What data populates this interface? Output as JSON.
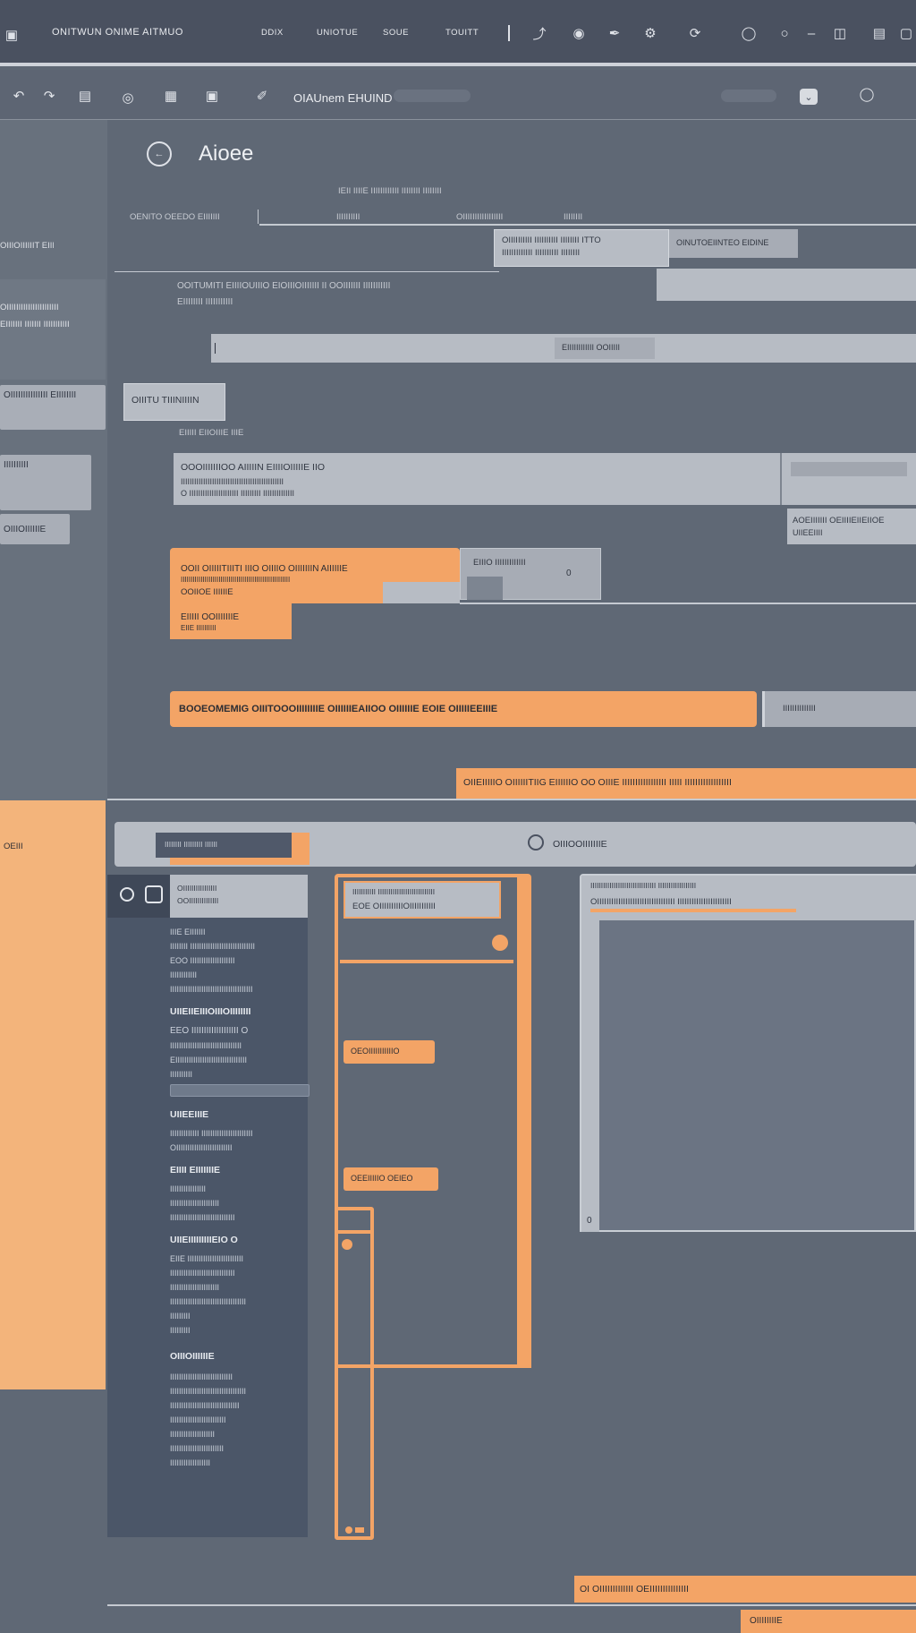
{
  "titlebar": {
    "app_title": "ONITWUN ONIME AITMUO",
    "menu": [
      "DDIX",
      "UNIOTUE",
      "SOUE",
      "TOUITT"
    ]
  },
  "toolbar": {
    "document_title": "OIAUnem EHUIND"
  },
  "page": {
    "heading": "Aioee",
    "subheading": "IEII IIIIE IIIIIIIIIIII IIIIIIII IIIIIIII",
    "col1": "OENITO OEEDO EIIIIIII",
    "col2": "IIIIIIIIII",
    "col3": "OIIIIIIIIIIIIIIIII",
    "col4": "IIIIIIII",
    "tip_line1": "OIIIIIIIIII IIIIIIIIII IIIIIIII ITTO",
    "tip_line2": "IIIIIIIIIIIII IIIIIIIIII IIIIIIII",
    "tip_side": "OINUTOEIINTEO EIDINE",
    "desc_line1": "OOITUMITI EIIIIOUIIIO EIOIIIOIIIIIII II OOIIIIIII IIIIIIIIIII",
    "desc_line2": "EIIIIIIII IIIIIIIIIII",
    "input_tag": "EIIIIIIIIIIII OOIIIII",
    "section_button": "OIIITU TIIINIIIIN",
    "section_label": "EIIIII EIIOIIIE IIIE",
    "box_title": "OOOIIIIIIIOO AIIIIIN EIIIIOIIIIIE IIO",
    "box_line1": "IIIIIIIIIIIIIIIIIIIIIIIIIIIIIIIIIIIIIIIIIIIIII",
    "box_line2": "O IIIIIIIIIIIIIIIIIIIIII IIIIIIIII IIIIIIIIIIIIII",
    "side_note1": "AOEIIIIIII OEIIIIEIIEIIOE",
    "side_note2": "UIIEEIIII",
    "orange_title": "OOII OIIIIITIIITI IIIO OIIIIO OIIIIIIIN AIIIIIIE",
    "orange_sub": "IIIIIIIIIIIIIIIIIIIIIIIIIIIIIIIIIIIIIIIIIIIIIIIIIIIIIII",
    "orange_sub2": "OOIIOE IIIIIIE",
    "side_grey_label": "EIIIO IIIIIIIIIIIII",
    "side_grey_value": "0",
    "small_orange_title": "EIIIII OOIIIIIIIE",
    "small_orange_sub": "EIIE IIIIIIIIII",
    "wide_banner": "BOOEOMEMIG OIIITOOOIIIIIIIIE OIIIIIIEAIIOO OIIIIIIE EOIE OIIIIIEEIIIE",
    "wide_banner_side": "IIIIIIIIIIIIII",
    "notice_banner": "OIIEIIIIIO OIIIIIITIIG EIIIIIIO OO OIIIE IIIIIIIIIIIIIIIII IIIII IIIIIIIIIIIIIIIIII",
    "orange_strip_text": "OEIII"
  },
  "workspace": {
    "tab_left": "IIIIIIII IIIIIIIII IIIIII",
    "tab_right": "OIIIOOIIIIIIIE",
    "panel_header_line1": "OIIIIIIIIIIIIIIII",
    "panel_header_line2": "OOIIIIIIIIIIIIII",
    "mid_header_line1": "IIIIIIIIIII IIIIIIIIIIIIIIIIIIIIIIIIIII",
    "mid_header_line2": "EOE OIIIIIIIIIIOIIIIIIIIIII",
    "mid_tag1": "OEOIIIIIIIIIIIO",
    "mid_tag2": "OEEIIIIIO OEIEO",
    "right_header_line1": "IIIIIIIIIIIIIIIIIIIIIIIIIIIIIII IIIIIIIIIIIIIIIIII",
    "right_header_line2": "OIIIIIIIIIIIIIIIIIIIIIIIIIIIIIIIII IIIIIIIIIIIIIIIIIIIIIII",
    "right_footer": "0",
    "bottom_banner": "OI OIIIIIIIIIIIII OEIIIIIIIIIIIIIII",
    "bottom_tag": "OIIIIIIIIE"
  },
  "left_panel": {
    "sections": [
      {
        "heading": "",
        "lines": [
          "IIIE EIIIIIII",
          "IIIIIIII IIIIIIIIIIIIIIIIIIIIIIIIIIIII",
          "EOO IIIIIIIIIIIIIIIIIIII",
          "IIIIIIIIIIII",
          "IIIIIIIIIIIIIIIIIIIIIIIIIIIIIIIIIIIII"
        ]
      },
      {
        "heading": "UIIEIIEIIIOIIIOIIIIIIII",
        "lines": []
      },
      {
        "heading": "",
        "lines": [
          "EEO IIIIIIIIIIIIIIIIIII O",
          "IIIIIIIIIIIIIIIIIIIIIIIIIIIIIIII",
          "EIIIIIIIIIIIIIIIIIIIIIIIIIIIIIIII",
          "IIIIIIIIII",
          "IIIIIIIIIIIIIIIIIIIIIIIIIIIIIII"
        ]
      },
      {
        "heading": "UIIEEIIIE",
        "lines": [
          "IIIIIIIIIIIII IIIIIIIIIIIIIIIIIIIIIII",
          "OIIIIIIIIIIIIIIIIIIIIIIIII"
        ]
      },
      {
        "heading": "EIIII EIIIIIIIE",
        "lines": [
          "IIIIIIIIIIIIIIII",
          "IIIIIIIIIIIIIIIIIIIIII",
          "IIIIIIIIIIIIIIIIIIIIIIIIIIIII"
        ]
      },
      {
        "heading": "UIIEIIIIIIIIIEIO O",
        "lines": [
          "EIIE IIIIIIIIIIIIIIIIIIIIIIIII",
          "IIIIIIIIIIIIIIIIIIIIIIIIIIIII",
          "IIIIIIIIIIIIIIIIIIIIII",
          "IIIIIIIIIIIIIIIIIIIIIIIIIIIIIIIIII",
          "IIIIIIIII",
          "IIIIIIIII"
        ]
      },
      {
        "heading": "OIIIOIIIIIIE",
        "lines": [
          "IIIIIIIIIIIIIIIIIIIIIIIIIIII",
          "IIIIIIIIIIIIIIIIIIIIIIIIIIIIIIIIII",
          "IIIIIIIIIIIIIIIIIIIIIIIIIIIIIII",
          "IIIIIIIIIIIIIIIIIIIIIIIII",
          "IIIIIIIIIIIIIIIIIIII",
          "IIIIIIIIIIIIIIIIIIIIIIII",
          "IIIIIIIIIIIIIIIIII"
        ]
      }
    ]
  },
  "leftnav": {
    "items": [
      "OIIIOIIIIIIT EIIIE",
      "OIIIIIIIIIIIIIIIIIIIIII EIIIIIII IIIIIII IIIIIIIIIII",
      "OIIIIIIIIIIIIIII EIIIIIIII",
      "IIIIIIIIII",
      "OIIIOIIIIIIE"
    ]
  }
}
